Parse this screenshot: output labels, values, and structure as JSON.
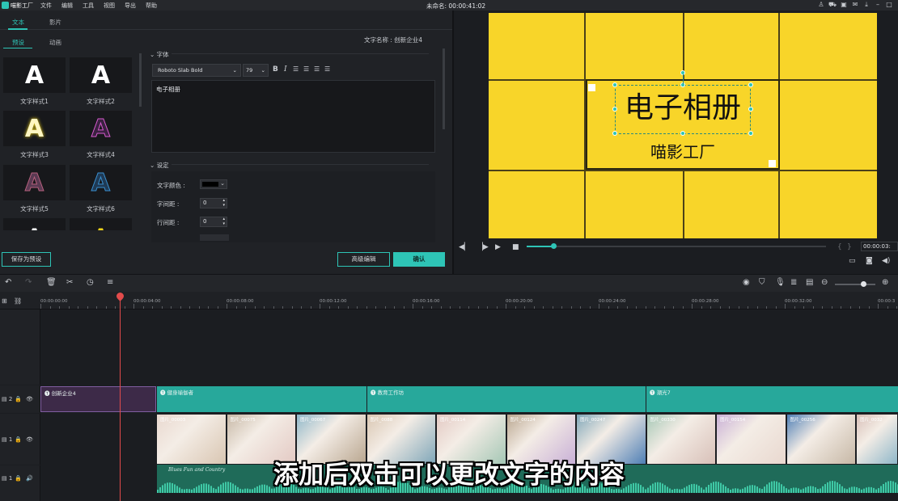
{
  "app": {
    "logo_text": "喵影工厂",
    "menu": [
      "文件",
      "编辑",
      "工具",
      "视图",
      "导出",
      "帮助"
    ],
    "title": "未命名: 00:00:41:02"
  },
  "left_panel": {
    "top_tabs": [
      "文本",
      "影片"
    ],
    "sub_tabs": [
      "预设",
      "动画"
    ],
    "styles": [
      {
        "letter": "A",
        "label": "文字样式1",
        "color": "#ffffff"
      },
      {
        "letter": "A",
        "label": "文字样式2",
        "color": "#ffffff"
      },
      {
        "letter": "A",
        "label": "文字样式3",
        "color": "#fff6c2"
      },
      {
        "letter": "A",
        "label": "文字样式4",
        "color": "#3a2140"
      },
      {
        "letter": "A",
        "label": "文字样式5",
        "color": "#5a3a52"
      },
      {
        "letter": "A",
        "label": "文字样式6",
        "color": "#1f3a55"
      },
      {
        "letter": "A",
        "label": "",
        "color": "#ffffff"
      },
      {
        "letter": "A",
        "label": "",
        "color": "#f2d51a"
      }
    ],
    "font_name_label": "文字名称 : 创新企业4",
    "font_section": "字体",
    "font_family": "Roboto Slab Bold",
    "font_size": "79",
    "text_content": "电子相册",
    "settings_section": "设定",
    "text_color_label": "文字颜色 :",
    "letter_spacing_label": "字间距 :",
    "letter_spacing_value": "0",
    "line_spacing_label": "行间距 :",
    "line_spacing_value": "0",
    "save_preset_button": "保存为预设",
    "advanced_edit_button": "高级编辑",
    "confirm_button": "确认"
  },
  "preview": {
    "main_text": "电子相册",
    "sub_text": "喵影工厂",
    "timecode": "00:00:03:",
    "progress": 0.09
  },
  "timeline": {
    "ruler_labels": [
      "00:00:00:00",
      "00:00:04:00",
      "00:00:08:00",
      "00:00:12:00",
      "00:00:16:00",
      "00:00:20:00",
      "00:00:24:00",
      "00:00:28:00",
      "00:00:32:00",
      "00:00:3"
    ],
    "title_clips": [
      "创新企业4",
      "健身瑜伽者",
      "教育工作坊",
      "潮光7"
    ],
    "video_clips": [
      "图片_00003",
      "图片_00075",
      "图片_00067",
      "图片_0088",
      "图片_00114",
      "图片_00124",
      "图片_00247",
      "图片_00330",
      "图片_00154",
      "图片_00256",
      "图片_0032"
    ],
    "audio_label": "Blues Fun and Country",
    "track_numbers": [
      "2",
      "1",
      "1"
    ]
  },
  "subtitle": "添加后双击可以更改文字的内容",
  "colors": {
    "accent": "#2ec4b6",
    "canvas": "#f8d529",
    "title_track": "#27a89b",
    "playhead": "#e24b4b"
  }
}
